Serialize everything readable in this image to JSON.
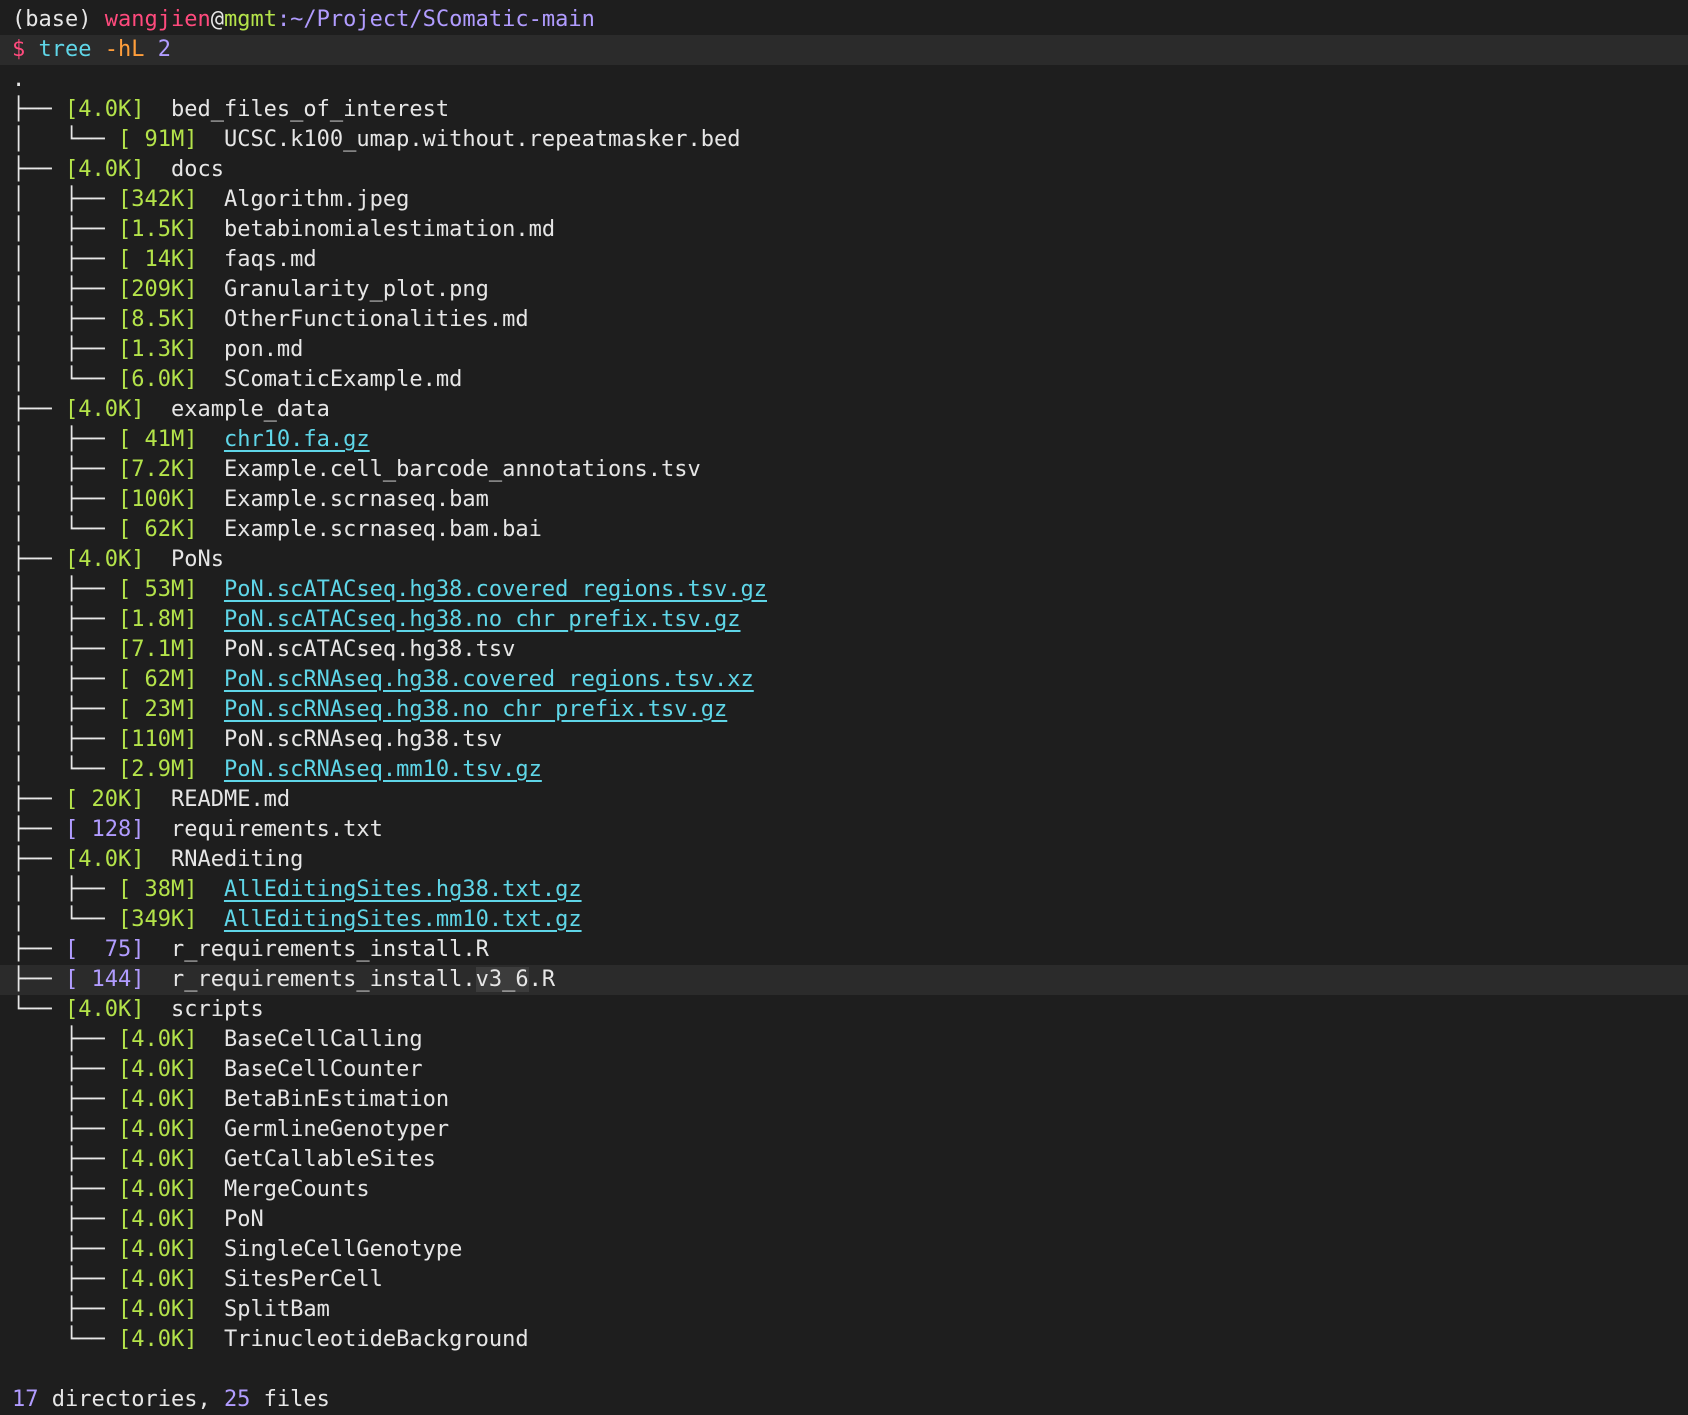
{
  "prompt": {
    "env": "(base)",
    "user": "wangjien",
    "at": "@",
    "host": "mgmt",
    "path": ":~/Project/SComatic-main"
  },
  "command": {
    "symbol": "$",
    "name": "tree",
    "flags": "-hL",
    "arg": "2"
  },
  "root": ".",
  "entries": [
    {
      "prefix": "├── ",
      "size": "[4.0K]",
      "name": "bed_files_of_interest"
    },
    {
      "prefix": "│   └── ",
      "size": "[ 91M]",
      "name": "UCSC.k100_umap.without.repeatmasker.bed"
    },
    {
      "prefix": "├── ",
      "size": "[4.0K]",
      "name": "docs"
    },
    {
      "prefix": "│   ├── ",
      "size": "[342K]",
      "name": "Algorithm.jpeg"
    },
    {
      "prefix": "│   ├── ",
      "size": "[1.5K]",
      "name": "betabinomialestimation.md"
    },
    {
      "prefix": "│   ├── ",
      "size": "[ 14K]",
      "name": "faqs.md"
    },
    {
      "prefix": "│   ├── ",
      "size": "[209K]",
      "name": "Granularity_plot.png"
    },
    {
      "prefix": "│   ├── ",
      "size": "[8.5K]",
      "name": "OtherFunctionalities.md"
    },
    {
      "prefix": "│   ├── ",
      "size": "[1.3K]",
      "name": "pon.md"
    },
    {
      "prefix": "│   └── ",
      "size": "[6.0K]",
      "name": "SComaticExample.md"
    },
    {
      "prefix": "├── ",
      "size": "[4.0K]",
      "name": "example_data"
    },
    {
      "prefix": "│   ├── ",
      "size": "[ 41M]",
      "name": "chr10.fa.gz",
      "link": true
    },
    {
      "prefix": "│   ├── ",
      "size": "[7.2K]",
      "name": "Example.cell_barcode_annotations.tsv"
    },
    {
      "prefix": "│   ├── ",
      "size": "[100K]",
      "name": "Example.scrnaseq.bam"
    },
    {
      "prefix": "│   └── ",
      "size": "[ 62K]",
      "name": "Example.scrnaseq.bam.bai"
    },
    {
      "prefix": "├── ",
      "size": "[4.0K]",
      "name": "PoNs"
    },
    {
      "prefix": "│   ├── ",
      "size": "[ 53M]",
      "name": "PoN.scATACseq.hg38.covered_regions.tsv.gz",
      "link": true
    },
    {
      "prefix": "│   ├── ",
      "size": "[1.8M]",
      "name": "PoN.scATACseq.hg38.no_chr_prefix.tsv.gz",
      "link": true
    },
    {
      "prefix": "│   ├── ",
      "size": "[7.1M]",
      "name": "PoN.scATACseq.hg38.tsv"
    },
    {
      "prefix": "│   ├── ",
      "size": "[ 62M]",
      "name": "PoN.scRNAseq.hg38.covered_regions.tsv.xz",
      "link": true
    },
    {
      "prefix": "│   ├── ",
      "size": "[ 23M]",
      "name": "PoN.scRNAseq.hg38.no_chr_prefix.tsv.gz",
      "link": true
    },
    {
      "prefix": "│   ├── ",
      "size": "[110M]",
      "name": "PoN.scRNAseq.hg38.tsv"
    },
    {
      "prefix": "│   └── ",
      "size": "[2.9M]",
      "name": "PoN.scRNAseq.mm10.tsv.gz",
      "link": true
    },
    {
      "prefix": "├── ",
      "size": "[ 20K]",
      "name": "README.md"
    },
    {
      "prefix": "├── ",
      "size": "[ 128]",
      "name": "requirements.txt",
      "plain_size": true
    },
    {
      "prefix": "├── ",
      "size": "[4.0K]",
      "name": "RNAediting"
    },
    {
      "prefix": "│   ├── ",
      "size": "[ 38M]",
      "name": "AllEditingSites.hg38.txt.gz",
      "link": true
    },
    {
      "prefix": "│   └── ",
      "size": "[349K]",
      "name": "AllEditingSites.mm10.txt.gz",
      "link": true
    },
    {
      "prefix": "├── ",
      "size": "[  75]",
      "name": "r_requirements_install.R",
      "plain_size": true
    },
    {
      "prefix": "├── ",
      "size": "[ 144]",
      "name": "r_requirements_install.v3_6.R",
      "plain_size": true,
      "highlight": true
    },
    {
      "prefix": "└── ",
      "size": "[4.0K]",
      "name": "scripts"
    },
    {
      "prefix": "    ├── ",
      "size": "[4.0K]",
      "name": "BaseCellCalling"
    },
    {
      "prefix": "    ├── ",
      "size": "[4.0K]",
      "name": "BaseCellCounter"
    },
    {
      "prefix": "    ├── ",
      "size": "[4.0K]",
      "name": "BetaBinEstimation"
    },
    {
      "prefix": "    ├── ",
      "size": "[4.0K]",
      "name": "GermlineGenotyper"
    },
    {
      "prefix": "    ├── ",
      "size": "[4.0K]",
      "name": "GetCallableSites"
    },
    {
      "prefix": "    ├── ",
      "size": "[4.0K]",
      "name": "MergeCounts"
    },
    {
      "prefix": "    ├── ",
      "size": "[4.0K]",
      "name": "PoN"
    },
    {
      "prefix": "    ├── ",
      "size": "[4.0K]",
      "name": "SingleCellGenotype"
    },
    {
      "prefix": "    ├── ",
      "size": "[4.0K]",
      "name": "SitesPerCell"
    },
    {
      "prefix": "    ├── ",
      "size": "[4.0K]",
      "name": "SplitBam"
    },
    {
      "prefix": "    └── ",
      "size": "[4.0K]",
      "name": "TrinucleotideBackground"
    }
  ],
  "highlight_selection": "v3_6",
  "summary": {
    "dir_count": "17",
    "dir_label": " directories, ",
    "file_count": "25",
    "file_label": " files"
  }
}
